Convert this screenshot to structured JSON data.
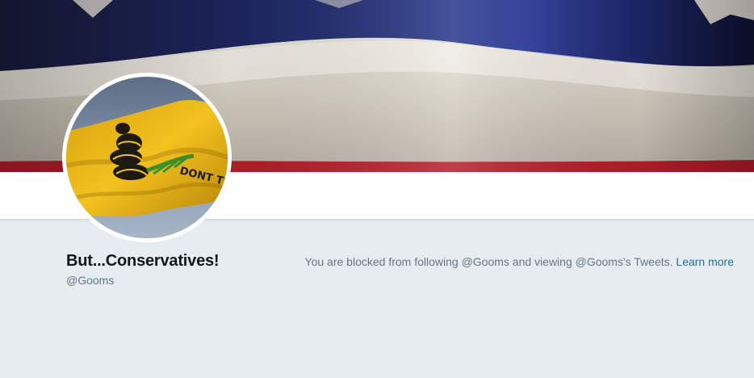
{
  "profile": {
    "name": "But...Conservatives!",
    "handle": "@Gooms",
    "avatar": {
      "flag_text": "DONT TREAD ON ME"
    }
  },
  "notice": {
    "text": "You are blocked from following @Gooms and viewing @Gooms's Tweets.",
    "link_label": "Learn more"
  },
  "colors": {
    "page_background": "#e6ecf0",
    "link": "#1c6fa3",
    "muted_text": "#657786",
    "name_text": "#14171a"
  }
}
